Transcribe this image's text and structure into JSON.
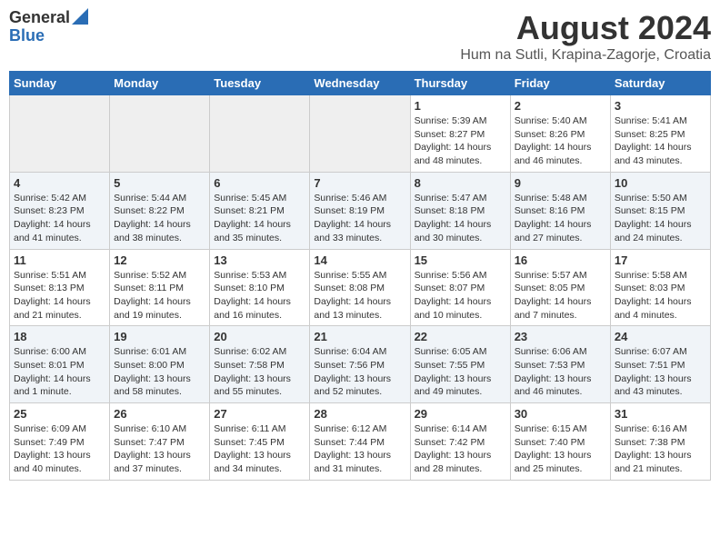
{
  "header": {
    "logo_general": "General",
    "logo_blue": "Blue",
    "title": "August 2024",
    "subtitle": "Hum na Sutli, Krapina-Zagorje, Croatia"
  },
  "weekdays": [
    "Sunday",
    "Monday",
    "Tuesday",
    "Wednesday",
    "Thursday",
    "Friday",
    "Saturday"
  ],
  "weeks": [
    [
      {
        "day": "",
        "info": ""
      },
      {
        "day": "",
        "info": ""
      },
      {
        "day": "",
        "info": ""
      },
      {
        "day": "",
        "info": ""
      },
      {
        "day": "1",
        "info": "Sunrise: 5:39 AM\nSunset: 8:27 PM\nDaylight: 14 hours\nand 48 minutes."
      },
      {
        "day": "2",
        "info": "Sunrise: 5:40 AM\nSunset: 8:26 PM\nDaylight: 14 hours\nand 46 minutes."
      },
      {
        "day": "3",
        "info": "Sunrise: 5:41 AM\nSunset: 8:25 PM\nDaylight: 14 hours\nand 43 minutes."
      }
    ],
    [
      {
        "day": "4",
        "info": "Sunrise: 5:42 AM\nSunset: 8:23 PM\nDaylight: 14 hours\nand 41 minutes."
      },
      {
        "day": "5",
        "info": "Sunrise: 5:44 AM\nSunset: 8:22 PM\nDaylight: 14 hours\nand 38 minutes."
      },
      {
        "day": "6",
        "info": "Sunrise: 5:45 AM\nSunset: 8:21 PM\nDaylight: 14 hours\nand 35 minutes."
      },
      {
        "day": "7",
        "info": "Sunrise: 5:46 AM\nSunset: 8:19 PM\nDaylight: 14 hours\nand 33 minutes."
      },
      {
        "day": "8",
        "info": "Sunrise: 5:47 AM\nSunset: 8:18 PM\nDaylight: 14 hours\nand 30 minutes."
      },
      {
        "day": "9",
        "info": "Sunrise: 5:48 AM\nSunset: 8:16 PM\nDaylight: 14 hours\nand 27 minutes."
      },
      {
        "day": "10",
        "info": "Sunrise: 5:50 AM\nSunset: 8:15 PM\nDaylight: 14 hours\nand 24 minutes."
      }
    ],
    [
      {
        "day": "11",
        "info": "Sunrise: 5:51 AM\nSunset: 8:13 PM\nDaylight: 14 hours\nand 21 minutes."
      },
      {
        "day": "12",
        "info": "Sunrise: 5:52 AM\nSunset: 8:11 PM\nDaylight: 14 hours\nand 19 minutes."
      },
      {
        "day": "13",
        "info": "Sunrise: 5:53 AM\nSunset: 8:10 PM\nDaylight: 14 hours\nand 16 minutes."
      },
      {
        "day": "14",
        "info": "Sunrise: 5:55 AM\nSunset: 8:08 PM\nDaylight: 14 hours\nand 13 minutes."
      },
      {
        "day": "15",
        "info": "Sunrise: 5:56 AM\nSunset: 8:07 PM\nDaylight: 14 hours\nand 10 minutes."
      },
      {
        "day": "16",
        "info": "Sunrise: 5:57 AM\nSunset: 8:05 PM\nDaylight: 14 hours\nand 7 minutes."
      },
      {
        "day": "17",
        "info": "Sunrise: 5:58 AM\nSunset: 8:03 PM\nDaylight: 14 hours\nand 4 minutes."
      }
    ],
    [
      {
        "day": "18",
        "info": "Sunrise: 6:00 AM\nSunset: 8:01 PM\nDaylight: 14 hours\nand 1 minute."
      },
      {
        "day": "19",
        "info": "Sunrise: 6:01 AM\nSunset: 8:00 PM\nDaylight: 13 hours\nand 58 minutes."
      },
      {
        "day": "20",
        "info": "Sunrise: 6:02 AM\nSunset: 7:58 PM\nDaylight: 13 hours\nand 55 minutes."
      },
      {
        "day": "21",
        "info": "Sunrise: 6:04 AM\nSunset: 7:56 PM\nDaylight: 13 hours\nand 52 minutes."
      },
      {
        "day": "22",
        "info": "Sunrise: 6:05 AM\nSunset: 7:55 PM\nDaylight: 13 hours\nand 49 minutes."
      },
      {
        "day": "23",
        "info": "Sunrise: 6:06 AM\nSunset: 7:53 PM\nDaylight: 13 hours\nand 46 minutes."
      },
      {
        "day": "24",
        "info": "Sunrise: 6:07 AM\nSunset: 7:51 PM\nDaylight: 13 hours\nand 43 minutes."
      }
    ],
    [
      {
        "day": "25",
        "info": "Sunrise: 6:09 AM\nSunset: 7:49 PM\nDaylight: 13 hours\nand 40 minutes."
      },
      {
        "day": "26",
        "info": "Sunrise: 6:10 AM\nSunset: 7:47 PM\nDaylight: 13 hours\nand 37 minutes."
      },
      {
        "day": "27",
        "info": "Sunrise: 6:11 AM\nSunset: 7:45 PM\nDaylight: 13 hours\nand 34 minutes."
      },
      {
        "day": "28",
        "info": "Sunrise: 6:12 AM\nSunset: 7:44 PM\nDaylight: 13 hours\nand 31 minutes."
      },
      {
        "day": "29",
        "info": "Sunrise: 6:14 AM\nSunset: 7:42 PM\nDaylight: 13 hours\nand 28 minutes."
      },
      {
        "day": "30",
        "info": "Sunrise: 6:15 AM\nSunset: 7:40 PM\nDaylight: 13 hours\nand 25 minutes."
      },
      {
        "day": "31",
        "info": "Sunrise: 6:16 AM\nSunset: 7:38 PM\nDaylight: 13 hours\nand 21 minutes."
      }
    ]
  ]
}
